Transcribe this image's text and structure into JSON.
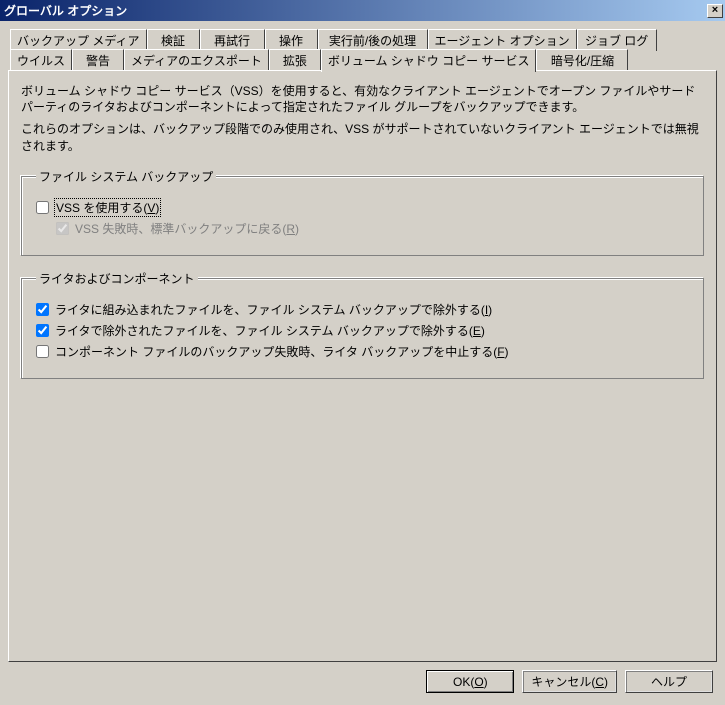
{
  "window": {
    "title": "グローバル オプション",
    "close_glyph": "×"
  },
  "tabs": {
    "row1": [
      "バックアップ メディア",
      "検証",
      "再試行",
      "操作",
      "実行前/後の処理",
      "エージェント オプション",
      "ジョブ ログ"
    ],
    "row2": [
      "ウイルス",
      "警告",
      "メディアのエクスポート",
      "拡張",
      "ボリューム シャドウ コピー サービス",
      "暗号化/圧縮"
    ],
    "active": "ボリューム シャドウ コピー サービス"
  },
  "desc1": "ボリューム シャドウ コピー サービス（VSS）を使用すると、有効なクライアント エージェントでオープン ファイルやサードパーティのライタおよびコンポーネントによって指定されたファイル グループをバックアップできます。",
  "desc2": "これらのオプションは、バックアップ段階でのみ使用され、VSS がサポートされていないクライアント エージェントでは無視されます。",
  "group1": {
    "legend": "ファイル システム バックアップ",
    "opt1_pre": "VSS を使用する(",
    "opt1_accel": "V",
    "opt1_post": ")",
    "opt2_pre": "VSS 失敗時、標準バックアップに戻る(",
    "opt2_accel": "R",
    "opt2_post": ")"
  },
  "group2": {
    "legend": "ライタおよびコンポーネント",
    "opt1_pre": "ライタに組み込まれたファイルを、ファイル システム バックアップで除外する(",
    "opt1_accel": "I",
    "opt1_post": ")",
    "opt2_pre": "ライタで除外されたファイルを、ファイル システム バックアップで除外する(",
    "opt2_accel": "E",
    "opt2_post": ")",
    "opt3_pre": "コンポーネント ファイルのバックアップ失敗時、ライタ バックアップを中止する(",
    "opt3_accel": "F",
    "opt3_post": ")"
  },
  "buttons": {
    "ok_pre": "OK(",
    "ok_accel": "O",
    "ok_post": ")",
    "cancel_pre": "キャンセル(",
    "cancel_accel": "C",
    "cancel_post": ")",
    "help": "ヘルプ"
  }
}
